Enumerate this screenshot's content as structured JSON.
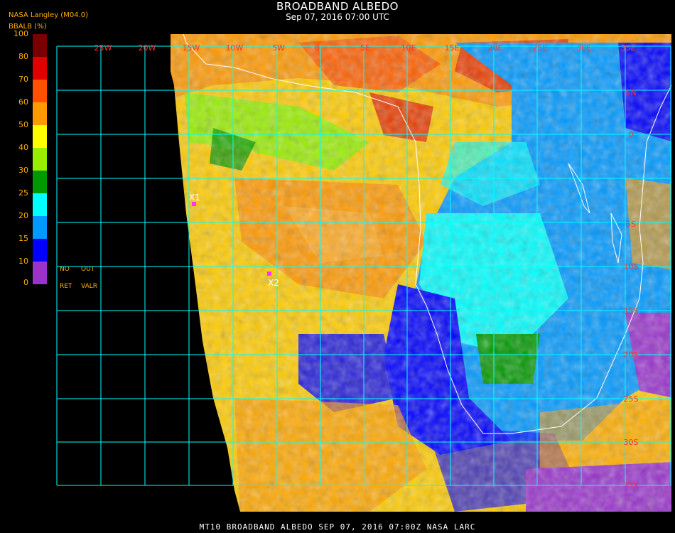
{
  "header": {
    "title": "BROADBAND ALBEDO",
    "datetime": "Sep 07, 2016 07:00 UTC",
    "organization": "NASA Langley (M04.0)",
    "unit_label": "BBALB (%)"
  },
  "colorbar": {
    "ticks": [
      "100",
      "80",
      "70",
      "60",
      "50",
      "40",
      "30",
      "25",
      "20",
      "15",
      "10",
      "0"
    ],
    "colors": [
      "#7a0000",
      "#e00000",
      "#ff5000",
      "#ff9900",
      "#ffff00",
      "#99ee00",
      "#009900",
      "#00ffff",
      "#0099ff",
      "#0000ff",
      "#9933cc"
    ],
    "no_data_labels": [
      "NO",
      "OUT",
      "RET",
      "VALR"
    ]
  },
  "map": {
    "lon_labels": [
      "25W",
      "20W",
      "15W",
      "10W",
      "5W",
      "0",
      "5E",
      "10E",
      "15E",
      "20E",
      "25E",
      "30E",
      "35E"
    ],
    "lat_labels": [
      "5N",
      "0",
      "5S",
      "10S",
      "15S",
      "20S",
      "25S",
      "30S",
      "35S"
    ],
    "markers": [
      "X1",
      "X2"
    ],
    "colors": {
      "grid": "#00ffff",
      "coast": "#ffffff",
      "marker": "#ff33ff"
    }
  },
  "footer": {
    "caption": "MT10  BROADBAND ALBEDO  SEP 07, 2016 07:00Z  NASA LARC"
  }
}
